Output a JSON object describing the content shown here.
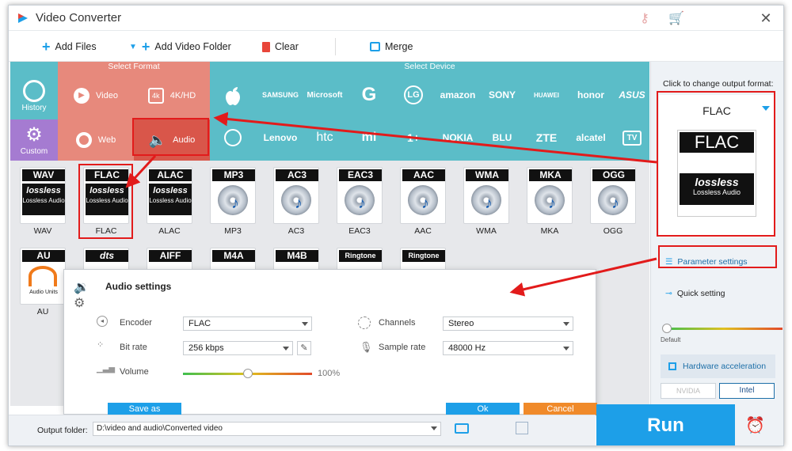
{
  "window": {
    "title": "Video Converter"
  },
  "toolbar": {
    "add_files": "Add Files",
    "add_folder": "Add Video Folder",
    "clear": "Clear",
    "merge": "Merge"
  },
  "headers": {
    "select_format": "Select Format",
    "select_device": "Select Device"
  },
  "left_tiles": {
    "history": "History",
    "custom": "Custom",
    "video": "Video",
    "hd": "4K/HD",
    "web": "Web",
    "audio": "Audio",
    "hd_icon": "4k"
  },
  "brands_row1": [
    "SAMSUNG",
    "Microsoft",
    "G",
    "LG",
    "amazon",
    "SONY",
    "HUAWEI",
    "honor",
    "ASUS"
  ],
  "brands_row2": [
    "Lenovo",
    "htc",
    "mi",
    "1+",
    "NOKIA",
    "BLU",
    "ZTE",
    "alcatel",
    "TV"
  ],
  "formats_row1": [
    {
      "name": "WAV",
      "label": "WAV"
    },
    {
      "name": "FLAC",
      "label": "FLAC"
    },
    {
      "name": "ALAC",
      "label": "ALAC"
    },
    {
      "name": "MP3",
      "label": "MP3"
    },
    {
      "name": "AC3",
      "label": "AC3"
    },
    {
      "name": "EAC3",
      "label": "EAC3"
    },
    {
      "name": "AAC",
      "label": "AAC"
    },
    {
      "name": "WMA",
      "label": "WMA"
    },
    {
      "name": "MKA",
      "label": "MKA"
    },
    {
      "name": "OGG",
      "label": "OGG"
    }
  ],
  "formats_row2": [
    {
      "name": "AU",
      "label": "AU"
    },
    {
      "name": "dts",
      "label": ""
    },
    {
      "name": "AIFF",
      "label": ""
    },
    {
      "name": "M4A",
      "label": ""
    },
    {
      "name": "M4B",
      "label": ""
    },
    {
      "name": "Ringtone",
      "label": ""
    },
    {
      "name": "Ringtone",
      "label": ""
    }
  ],
  "lossless": {
    "logo": "lossless",
    "text": "Lossless Audio"
  },
  "au_badge_text": "Audio Units",
  "dialog": {
    "title": "Audio settings",
    "encoder_label": "Encoder",
    "encoder_value": "FLAC",
    "bitrate_label": "Bit rate",
    "bitrate_value": "256 kbps",
    "volume_label": "Volume",
    "volume_value": "100%",
    "volume_level": 0.5,
    "channels_label": "Channels",
    "channels_value": "Stereo",
    "samplerate_label": "Sample rate",
    "samplerate_value": "48000 Hz",
    "save_as": "Save as",
    "ok": "Ok",
    "cancel": "Cancel"
  },
  "right_panel": {
    "hint": "Click to change output format:",
    "format": "FLAC",
    "format_badge": "FLAC",
    "lossless_logo": "lossless",
    "lossless_text": "Lossless Audio",
    "param_settings": "Parameter settings",
    "quick_setting": "Quick setting",
    "default_label": "Default",
    "hw_accel": "Hardware acceleration",
    "nvidia": "NVIDIA",
    "intel": "Intel"
  },
  "bottom": {
    "output_label": "Output folder:",
    "output_path": "D:\\video and audio\\Converted video",
    "run": "Run"
  },
  "colors": {
    "accent_blue": "#1d9fe8",
    "teal": "#5bbdc8",
    "salmon": "#e7897c",
    "purple": "#a57bd1",
    "highlight_red": "#e21b1b",
    "cancel_orange": "#f08a2a"
  }
}
